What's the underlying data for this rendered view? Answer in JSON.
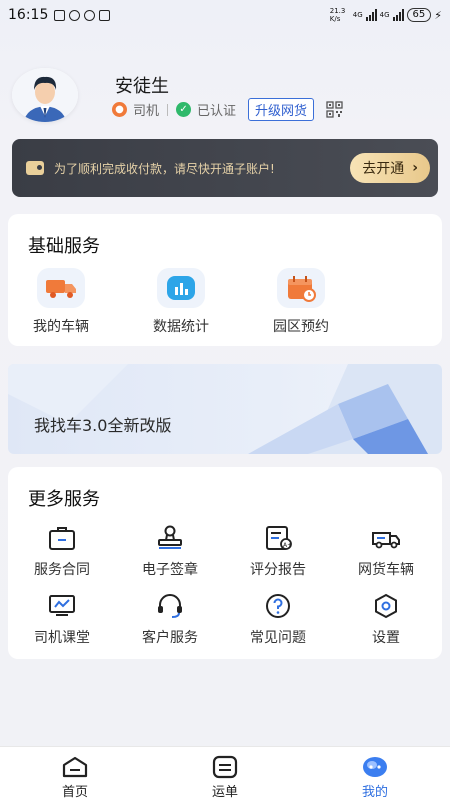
{
  "status_bar": {
    "time": "16:15",
    "net_speed": "21.3 K/s",
    "signal1": "4G",
    "signal2": "4G",
    "battery": "65"
  },
  "profile": {
    "name": "安徒生",
    "role": "司机",
    "verified": "已认证",
    "upgrade_label": "升级网货"
  },
  "notice": {
    "text": "为了顺利完成收付款，请尽快开通子账户!",
    "action_label": "去开通"
  },
  "basic_services": {
    "title": "基础服务",
    "items": [
      {
        "label": "我的车辆",
        "icon": "truck-icon"
      },
      {
        "label": "数据统计",
        "icon": "chart-icon"
      },
      {
        "label": "园区预约",
        "icon": "calendar-icon"
      }
    ]
  },
  "promo": {
    "text": "我找车3.0全新改版"
  },
  "more_services": {
    "title": "更多服务",
    "items": [
      {
        "label": "服务合同",
        "icon": "briefcase-icon"
      },
      {
        "label": "电子签章",
        "icon": "stamp-icon"
      },
      {
        "label": "评分报告",
        "icon": "report-icon"
      },
      {
        "label": "网货车辆",
        "icon": "truck-outline-icon"
      },
      {
        "label": "司机课堂",
        "icon": "classroom-icon"
      },
      {
        "label": "客户服务",
        "icon": "headset-icon"
      },
      {
        "label": "常见问题",
        "icon": "question-icon"
      },
      {
        "label": "设置",
        "icon": "settings-icon"
      }
    ]
  },
  "tabs": [
    {
      "label": "首页",
      "icon": "home-icon"
    },
    {
      "label": "运单",
      "icon": "waybill-icon"
    },
    {
      "label": "我的",
      "icon": "profile-icon"
    }
  ],
  "colors": {
    "accent": "#2f6fe0",
    "notice_bg": "#3a3d45",
    "notice_text": "#e6d2a8",
    "orange": "#f07a3a"
  }
}
